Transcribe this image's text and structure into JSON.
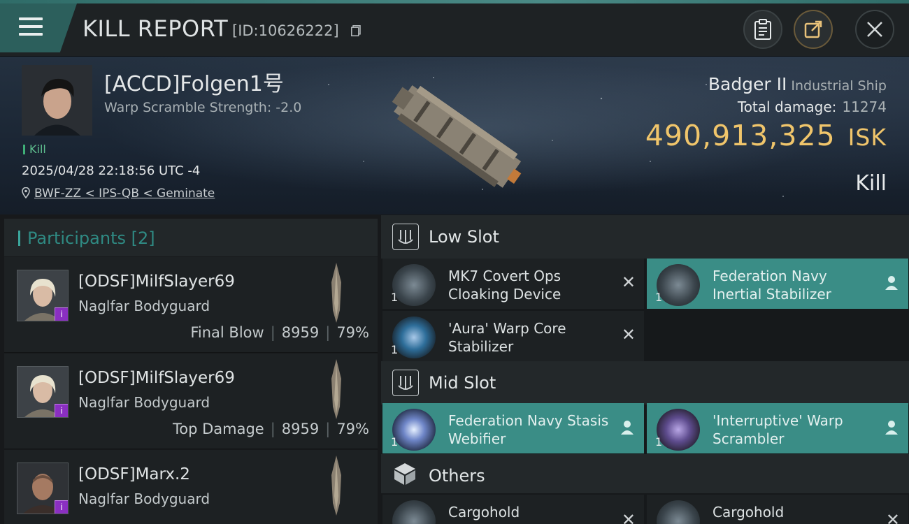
{
  "header": {
    "title": "KILL REPORT",
    "id_text": "[ID:10626222]"
  },
  "victim": {
    "name": "[ACCD]Folgen1号",
    "warp_scramble": "Warp Scramble Strength: -2.0",
    "kill_tag": "Kill",
    "datetime": "2025/04/28 22:18:56 UTC -4",
    "location": "BWF-ZZ < IPS-QB < Geminate"
  },
  "ship": {
    "name": "Badger II",
    "class": "Industrial Ship",
    "total_damage_label": "Total damage:",
    "total_damage_value": "11274",
    "isk_value": "490,913,325",
    "isk_unit": "ISK",
    "result": "Kill"
  },
  "participants": {
    "title": "Participants [2]",
    "rows": [
      {
        "name": "[ODSF]MilfSlayer69",
        "ship": "Naglfar Bodyguard",
        "label": "Final Blow",
        "damage": "8959",
        "percent": "79%"
      },
      {
        "name": "[ODSF]MilfSlayer69",
        "ship": "Naglfar Bodyguard",
        "label": "Top Damage",
        "damage": "8959",
        "percent": "79%"
      },
      {
        "name": "[ODSF]Marx.2",
        "ship": "Naglfar Bodyguard",
        "label": "",
        "damage": "",
        "percent": ""
      }
    ]
  },
  "fitting": {
    "low_slot": {
      "label": "Low Slot",
      "modules": [
        {
          "name": "MK7 Covert Ops Cloaking Device",
          "qty": "1",
          "status": "destroyed"
        },
        {
          "name": "Federation Navy Inertial Stabilizer",
          "qty": "1",
          "status": "dropped"
        },
        {
          "name": "'Aura' Warp Core Stabilizer",
          "qty": "1",
          "status": "destroyed"
        }
      ]
    },
    "mid_slot": {
      "label": "Mid Slot",
      "modules": [
        {
          "name": "Federation Navy Stasis Webifier",
          "qty": "1",
          "status": "dropped"
        },
        {
          "name": "'Interruptive' Warp Scrambler",
          "qty": "1",
          "status": "dropped"
        }
      ]
    },
    "others": {
      "label": "Others",
      "modules": [
        {
          "name": "Cargohold",
          "qty": "",
          "status": "destroyed"
        },
        {
          "name": "Cargohold",
          "qty": "",
          "status": "destroyed"
        }
      ]
    }
  },
  "icons": {
    "menu": "hamburger-icon",
    "copy": "copy-icon",
    "clipboard": "clipboard-icon",
    "share": "share-icon",
    "close": "close-icon",
    "location": "location-pin-icon",
    "destroyed": "x-mark-icon",
    "dropped": "person-icon"
  },
  "colors": {
    "accent": "#3a8d86",
    "isk": "#f0c56b",
    "kill_green": "#3fae77",
    "badge_purple": "#8a2fc1"
  }
}
